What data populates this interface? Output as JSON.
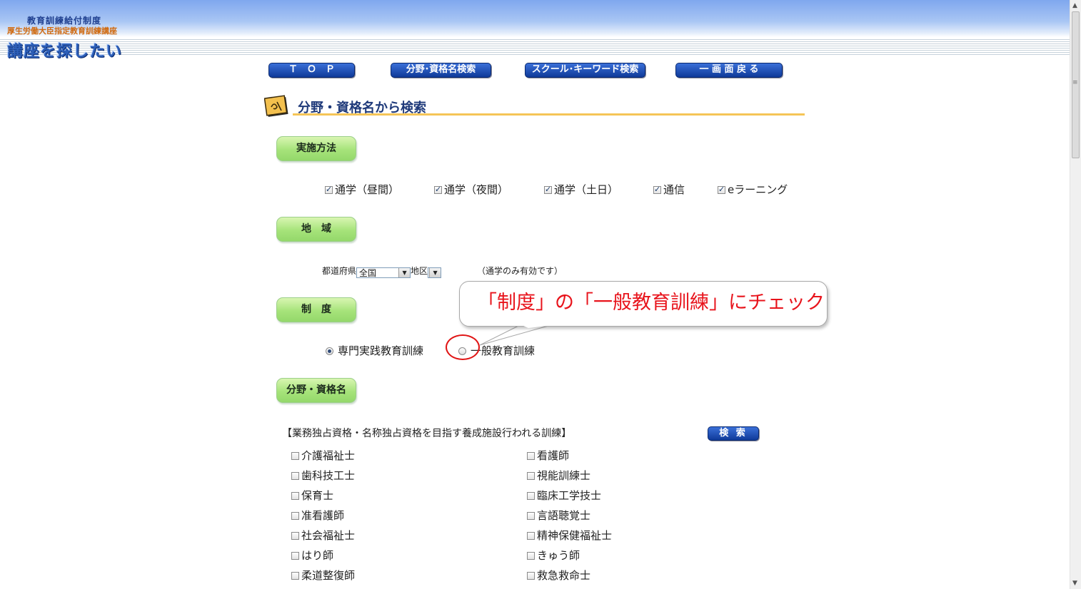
{
  "header": {
    "logo_line1": "教育訓練給付制度",
    "logo_line2": "厚生労働大臣指定教育訓練講座",
    "logo_main": "講座を探したい"
  },
  "nav": {
    "top": "Ｔ　Ｏ　Ｐ",
    "field_search": "分野･資格名検索",
    "school_search": "スクール･キーワード検索",
    "back": "一 画 面 戻 る"
  },
  "section": {
    "title": "分野・資格名から検索"
  },
  "method": {
    "label": "実施方法",
    "options": [
      {
        "label": "通学（昼間）",
        "checked": true
      },
      {
        "label": "通学（夜間）",
        "checked": true
      },
      {
        "label": "通学（土日）",
        "checked": true
      },
      {
        "label": "通信",
        "checked": true
      },
      {
        "label": "eラーニング",
        "checked": true
      }
    ]
  },
  "region": {
    "label": "地　域",
    "pref_label": "都道府県",
    "pref_value": "全国",
    "district_label": "地区",
    "district_value": "",
    "note": "（通学のみ有効です）"
  },
  "system": {
    "label": "制　度",
    "options": [
      {
        "label": "専門実践教育訓練",
        "selected": true
      },
      {
        "label": "一般教育訓練",
        "selected": false
      }
    ]
  },
  "callout": {
    "text": "「制度」の「一般教育訓練」にチェック"
  },
  "field": {
    "label": "分野・資格名",
    "group_title": "【業務独占資格・名称独占資格を目指す養成施設行われる訓練】",
    "search_button": "検 索",
    "left_items": [
      "介護福祉士",
      "歯科技工士",
      "保育士",
      "准看護師",
      "社会福祉士",
      "はり師",
      "柔道整復師"
    ],
    "right_items": [
      "看護師",
      "視能訓練士",
      "臨床工学技士",
      "言語聴覚士",
      "精神保健福祉士",
      "きゅう師",
      "救急救命士"
    ]
  },
  "colors": {
    "nav_button": "#1f4fb8",
    "green_label": "#a6e37a",
    "accent_line": "#f5c557",
    "callout_red": "#e8141c"
  }
}
